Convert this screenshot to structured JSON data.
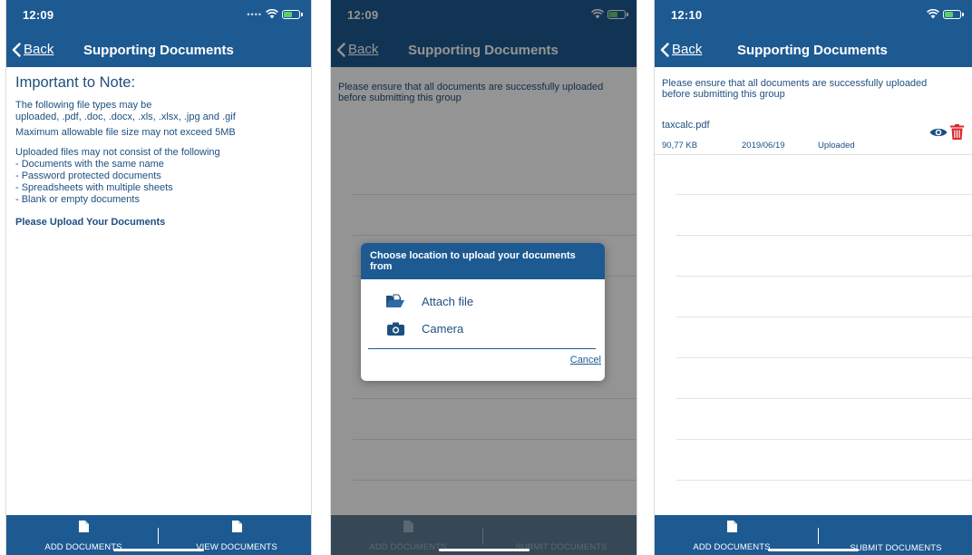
{
  "screens": [
    {
      "time": "12:09",
      "nav": {
        "back_label": "Back",
        "title": "Supporting Documents"
      },
      "note": {
        "heading": "Important to Note:",
        "file_types": "The following file types may be\nuploaded,  .pdf, .doc, .docx, .xls, .xlsx, .jpg and .gif",
        "max_size": "Maximum allowable file size may not exceed 5MB",
        "restrictions": "Uploaded files may not consist of the following\n- Documents with the same name\n- Password protected documents\n- Spreadsheets with multiple sheets\n- Blank or empty documents",
        "call_to_action": "Please Upload Your Documents"
      },
      "bottom": {
        "left_label": "ADD DOCUMENTS",
        "right_label": "VIEW DOCUMENTS"
      }
    },
    {
      "time": "12:09",
      "nav": {
        "back_label": "Back",
        "title": "Supporting Documents"
      },
      "info_text": "Please ensure that all documents are successfully uploaded before submitting this group",
      "dialog": {
        "title": "Choose location to upload your documents from",
        "options": [
          {
            "label": "Attach file",
            "icon": "folder-icon"
          },
          {
            "label": "Camera",
            "icon": "camera-icon"
          }
        ],
        "cancel_label": "Cancel"
      },
      "bottom": {
        "left_label": "ADD DOCUMENTS",
        "right_label": "SUBMIT DOCUMENTS"
      }
    },
    {
      "time": "12:10",
      "nav": {
        "back_label": "Back",
        "title": "Supporting Documents"
      },
      "info_text": "Please ensure that all documents are successfully uploaded before submitting this group",
      "files": [
        {
          "name": "taxcalc.pdf",
          "size": "90,77 KB",
          "date": "2019/06/19",
          "status": "Uploaded"
        }
      ],
      "bottom": {
        "left_label": "ADD DOCUMENTS",
        "right_label": "SUBMIT DOCUMENTS"
      }
    }
  ],
  "colors": {
    "primary": "#1e5a92",
    "text": "#1e4f80",
    "delete": "#e0262a",
    "battery": "#5bd16a"
  }
}
